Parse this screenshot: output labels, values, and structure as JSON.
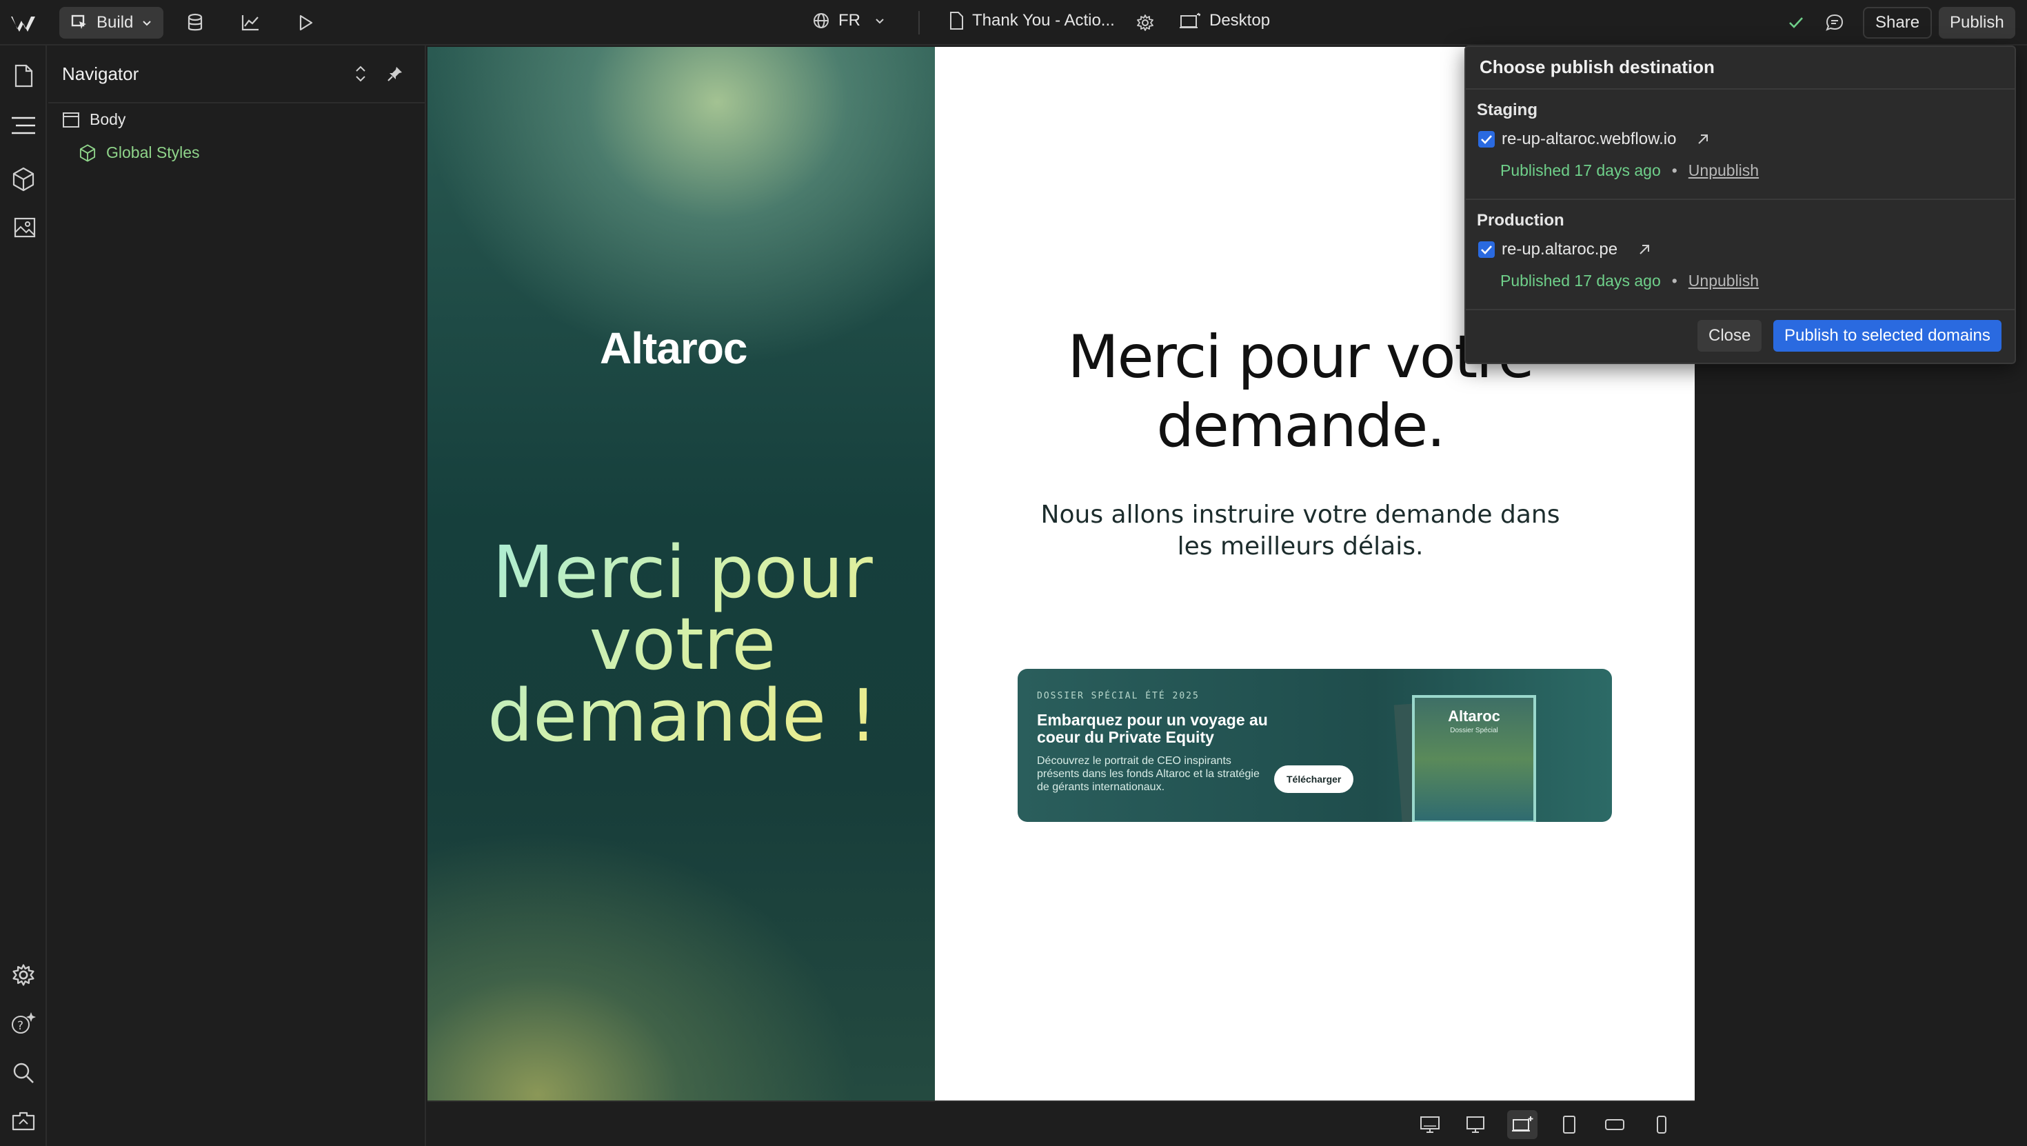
{
  "topbar": {
    "build_label": "Build",
    "locale_label": "FR",
    "page_name": "Thank You - Actio...",
    "breakpoint_label": "Desktop",
    "share_label": "Share",
    "publish_label": "Publish"
  },
  "navigator": {
    "title": "Navigator",
    "tree": [
      {
        "label": "Body"
      },
      {
        "label": "Global Styles"
      }
    ]
  },
  "canvas": {
    "left": {
      "logo": "Altaroc",
      "heading": "Merci pour votre demande !"
    },
    "right": {
      "heading": "Merci pour votre demande.",
      "subtext": "Nous allons instruire votre demande dans les meilleurs délais.",
      "banner": {
        "kicker": "DOSSIER SPÉCIAL ÉTÉ 2025",
        "title": "Embarquez pour un voyage au coeur du Private Equity",
        "description": "Découvrez le portrait de CEO inspirants présents dans les fonds Altaroc et la stratégie de gérants internationaux.",
        "cta": "Télécharger",
        "mag_logo": "Altaroc",
        "mag_sub": "Dossier Spécial"
      }
    }
  },
  "publish_popup": {
    "title": "Choose publish destination",
    "staging": {
      "section_label": "Staging",
      "domain": "re-up-altaroc.webflow.io",
      "status": "Published 17 days ago",
      "unpublish": "Unpublish",
      "checked": true
    },
    "production": {
      "section_label": "Production",
      "domain": "re-up.altaroc.pe",
      "status": "Published 17 days ago",
      "unpublish": "Unpublish",
      "checked": true
    },
    "close_label": "Close",
    "publish_selected_label": "Publish to selected domains"
  },
  "colors": {
    "accent": "#2a6ae0",
    "success": "#6fd08a",
    "global_styles": "#8fd48a"
  }
}
